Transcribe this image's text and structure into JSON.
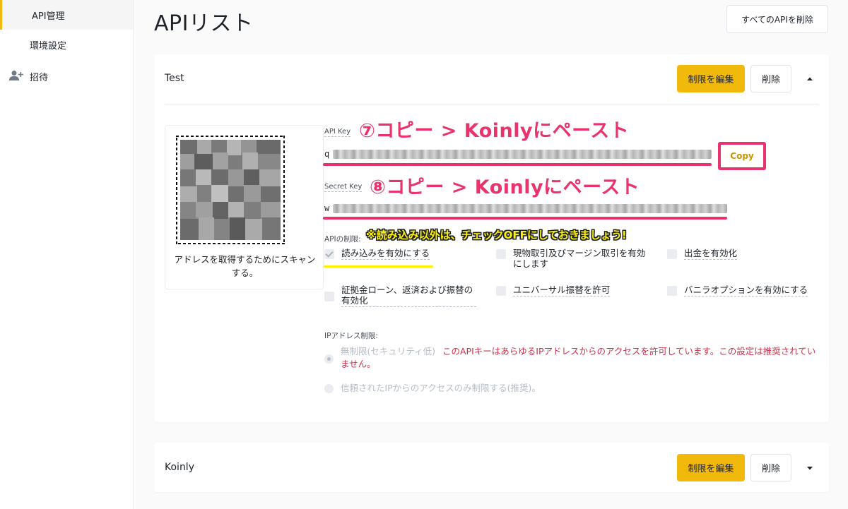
{
  "sidebar": {
    "items": [
      {
        "label": "API管理",
        "active": true
      },
      {
        "label": "環境設定",
        "active": false
      },
      {
        "label": "招待",
        "icon": "add-user-icon",
        "active": false
      }
    ]
  },
  "header": {
    "title": "APIリスト",
    "delete_all_label": "すべてのAPIを削除"
  },
  "cards": [
    {
      "name": "Test",
      "edit_label": "制限を編集",
      "delete_label": "削除",
      "expanded": true,
      "qr_caption": "アドレスを取得するためにスキャンする。",
      "api_key_label": "API Key",
      "api_key_prefix": "q",
      "copy_label": "Copy",
      "secret_key_label": "Secret Key",
      "secret_key_prefix": "w",
      "restrictions_label": "APIの制限:",
      "permissions": [
        {
          "label": "読み込みを有効にする",
          "checked": true
        },
        {
          "label": "現物取引及びマージン取引を有効にします",
          "checked": false
        },
        {
          "label": "出金を有効化",
          "checked": false
        },
        {
          "label": "証拠金ローン、返済および振替の有効化",
          "checked": false
        },
        {
          "label": "ユニバーサル振替を許可",
          "checked": false
        },
        {
          "label": "バニラオプションを有効にする",
          "checked": false
        }
      ],
      "ip_label": "IPアドレス制限:",
      "ip_options": [
        {
          "label": "無制限(セキュリティ低)",
          "selected": true,
          "warning": "このAPIキーはあらゆるIPアドレスからのアクセスを許可しています。この設定は推奨されていません。"
        },
        {
          "label": "信頼されたIPからのアクセスのみ制限する(推奨)。",
          "selected": false
        }
      ]
    },
    {
      "name": "Koinly",
      "edit_label": "制限を編集",
      "delete_label": "削除",
      "expanded": false
    }
  ],
  "annotations": {
    "api_key": "⑦コピー > Koinlyにペースト",
    "secret_key": "⑧コピー > Koinlyにペースト",
    "warning": "※読み込み以外は、チェックOFFにしておきましょう!"
  },
  "colors": {
    "brand_yellow": "#f0b90b",
    "annotation_pink": "#e8336d",
    "warning_red": "#cf304a",
    "highlight_yellow": "#fff200"
  }
}
